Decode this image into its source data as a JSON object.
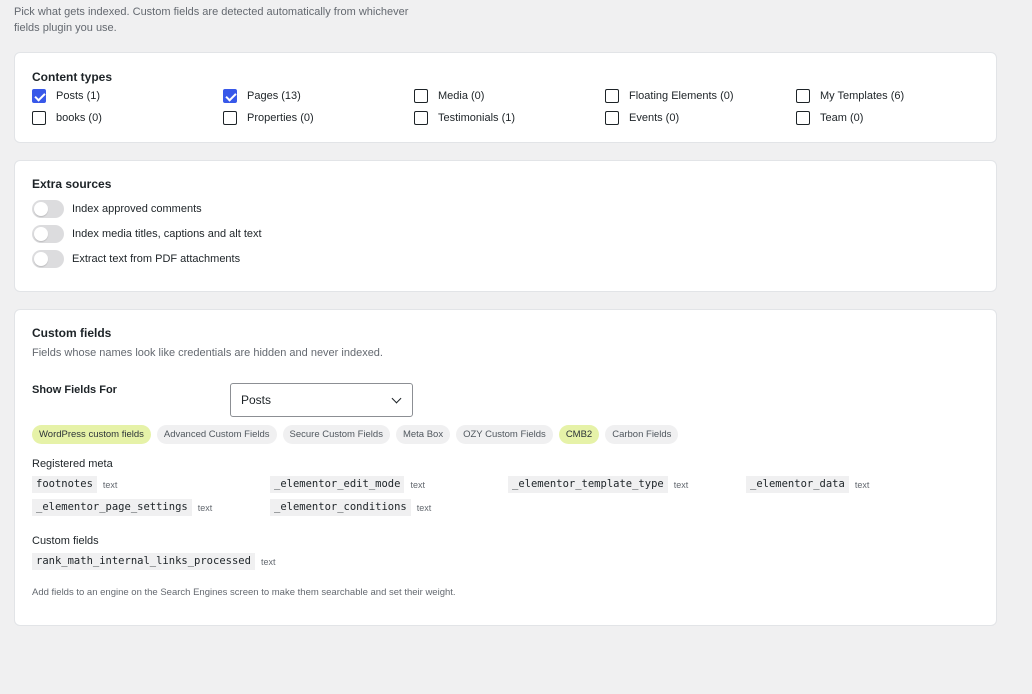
{
  "intro": {
    "line1": "Pick what gets indexed. Custom fields are detected automatically from whichever",
    "line2": "fields plugin you use."
  },
  "content_types": {
    "title": "Content types",
    "items": [
      {
        "label": "Posts (1)",
        "checked": true
      },
      {
        "label": "Pages (13)",
        "checked": true
      },
      {
        "label": "Media (0)",
        "checked": false
      },
      {
        "label": "Floating Elements (0)",
        "checked": false
      },
      {
        "label": "My Templates (6)",
        "checked": false
      },
      {
        "label": "books (0)",
        "checked": false
      },
      {
        "label": "Properties (0)",
        "checked": false
      },
      {
        "label": "Testimonials (1)",
        "checked": false
      },
      {
        "label": "Events (0)",
        "checked": false
      },
      {
        "label": "Team (0)",
        "checked": false
      }
    ]
  },
  "extra_sources": {
    "title": "Extra sources",
    "toggles": [
      {
        "label": "Index approved comments",
        "on": false
      },
      {
        "label": "Index media titles, captions and alt text",
        "on": false
      },
      {
        "label": "Extract text from PDF attachments",
        "on": false
      }
    ]
  },
  "custom_fields": {
    "title": "Custom fields",
    "subtitle": "Fields whose names look like credentials are hidden and never indexed.",
    "show_for_label": "Show Fields For",
    "show_for_value": "Posts",
    "sources": [
      {
        "label": "WordPress custom fields",
        "active": true
      },
      {
        "label": "Advanced Custom Fields",
        "active": false
      },
      {
        "label": "Secure Custom Fields",
        "active": false
      },
      {
        "label": "Meta Box",
        "active": false
      },
      {
        "label": "OZY Custom Fields",
        "active": false
      },
      {
        "label": "CMB2",
        "active": true
      },
      {
        "label": "Carbon Fields",
        "active": false
      }
    ],
    "registered_meta_label": "Registered meta",
    "registered_meta": [
      {
        "name": "footnotes",
        "type": "text"
      },
      {
        "name": "_elementor_edit_mode",
        "type": "text"
      },
      {
        "name": "_elementor_template_type",
        "type": "text"
      },
      {
        "name": "_elementor_data",
        "type": "text"
      },
      {
        "name": "_elementor_page_settings",
        "type": "text"
      },
      {
        "name": "_elementor_conditions",
        "type": "text"
      }
    ],
    "custom_fields_label": "Custom fields",
    "custom": [
      {
        "name": "rank_math_internal_links_processed",
        "type": "text"
      }
    ],
    "note": "Add fields to an engine on the Search Engines screen to make them searchable and set their weight."
  },
  "colors": {
    "checkbox_checked": "#3858e9",
    "pill_active": "#e6f2a8"
  }
}
